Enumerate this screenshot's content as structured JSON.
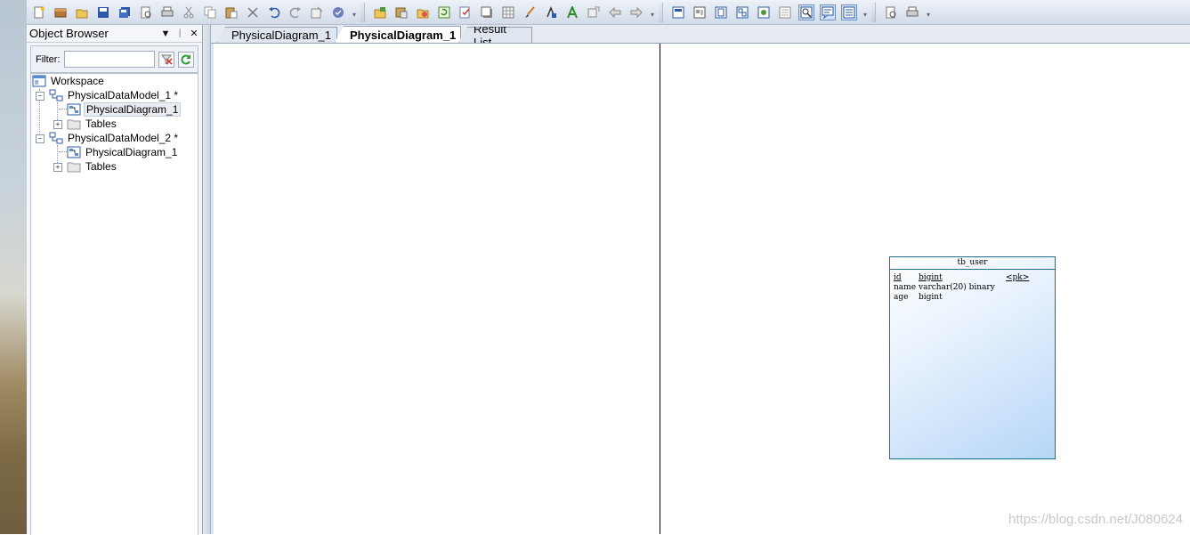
{
  "toolbar": {
    "groups": [
      [
        "new-icon",
        "open-model-icon",
        "open-folder-icon",
        "save-icon",
        "save-all-icon",
        "print-preview-icon",
        "print-icon",
        "cut-icon",
        "copy-icon",
        "paste-icon",
        "delete-icon",
        "undo-icon",
        "redo-icon",
        "properties-icon",
        "check-model-icon"
      ],
      [
        "new-package-icon",
        "import-icon",
        "reverse-engineer-icon",
        "update-icon",
        "check-icon",
        "shadow-icon",
        "grid-icon",
        "brush-icon",
        "format-icon",
        "text-color-icon",
        "link-icon",
        "back-icon",
        "forward-icon"
      ],
      [
        "view-1-icon",
        "view-2-icon",
        "view-3-icon",
        "view-4-icon",
        "view-5-icon",
        "view-6-icon",
        "zoom-page-icon",
        "comment-icon",
        "list-icon"
      ],
      [
        "print-preview-2-icon",
        "print-2-icon"
      ]
    ]
  },
  "object_browser": {
    "title": "Object Browser",
    "pin_symbol": "▾  ⊥",
    "close_symbol": "✕",
    "filter_label": "Filter:",
    "filter_value": "",
    "tree": {
      "workspace": "Workspace",
      "model1": "PhysicalDataModel_1 *",
      "model1_diagram": "PhysicalDiagram_1",
      "model1_tables": "Tables",
      "model2": "PhysicalDataModel_2 *",
      "model2_diagram": "PhysicalDiagram_1",
      "model2_tables": "Tables"
    }
  },
  "tabs": {
    "tab1": "PhysicalDiagram_1",
    "tab2": "PhysicalDiagram_1",
    "tab3": "Result List"
  },
  "entity": {
    "name": "tb_user",
    "columns": [
      {
        "name": "id",
        "type": "bigint",
        "key": "<pk>"
      },
      {
        "name": "name",
        "type": "varchar(20) binary",
        "key": ""
      },
      {
        "name": "age",
        "type": "bigint",
        "key": ""
      }
    ]
  },
  "watermark": "https://blog.csdn.net/J080624"
}
